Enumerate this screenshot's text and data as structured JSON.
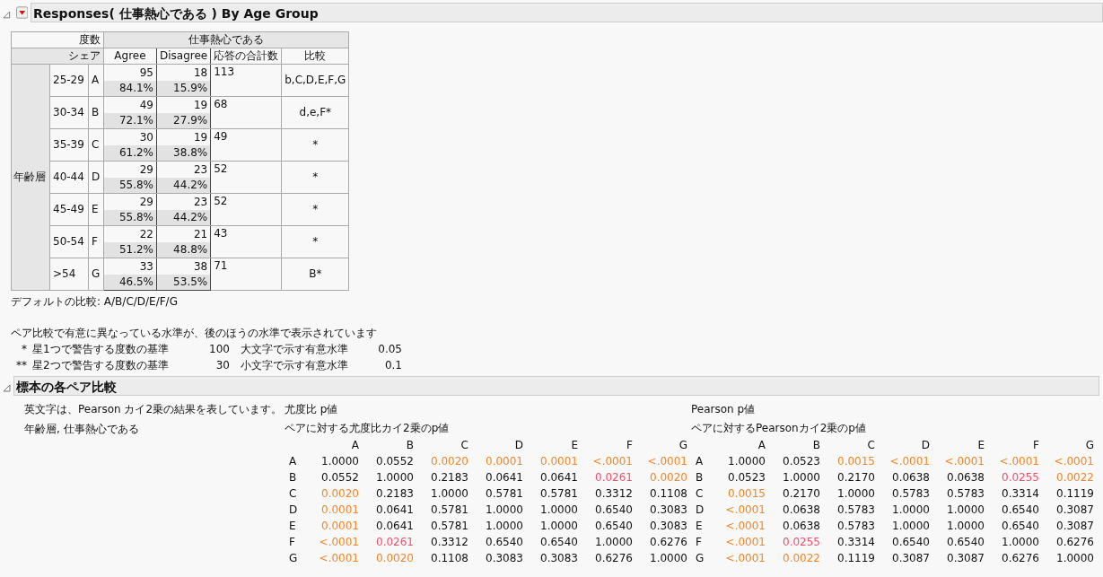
{
  "report": {
    "title": "Responses( 仕事熱心である ) By Age Group"
  },
  "crosstab": {
    "corner_top": "度数",
    "corner_bottom": "シェア",
    "column_group": "仕事熱心である",
    "columns": [
      "Agree",
      "Disagree",
      "応答の合計数",
      "比較"
    ],
    "row_group": "年齢層",
    "rows": [
      {
        "range": "25-29",
        "letter": "A",
        "counts": [
          {
            "count": "95",
            "share": "84.1%"
          },
          {
            "count": "18",
            "share": "15.9%"
          }
        ],
        "total": "113",
        "comparison": "b,C,D,E,F,G"
      },
      {
        "range": "30-34",
        "letter": "B",
        "counts": [
          {
            "count": "49",
            "share": "72.1%"
          },
          {
            "count": "19",
            "share": "27.9%"
          }
        ],
        "total": "68",
        "comparison": "d,e,F*"
      },
      {
        "range": "35-39",
        "letter": "C",
        "counts": [
          {
            "count": "30",
            "share": "61.2%"
          },
          {
            "count": "19",
            "share": "38.8%"
          }
        ],
        "total": "49",
        "comparison": "*"
      },
      {
        "range": "40-44",
        "letter": "D",
        "counts": [
          {
            "count": "29",
            "share": "55.8%"
          },
          {
            "count": "23",
            "share": "44.2%"
          }
        ],
        "total": "52",
        "comparison": "*"
      },
      {
        "range": "45-49",
        "letter": "E",
        "counts": [
          {
            "count": "29",
            "share": "55.8%"
          },
          {
            "count": "23",
            "share": "44.2%"
          }
        ],
        "total": "52",
        "comparison": "*"
      },
      {
        "range": "50-54",
        "letter": "F",
        "counts": [
          {
            "count": "22",
            "share": "51.2%"
          },
          {
            "count": "21",
            "share": "48.8%"
          }
        ],
        "total": "43",
        "comparison": "*"
      },
      {
        "range": ">54",
        "letter": "G",
        "counts": [
          {
            "count": "33",
            "share": "46.5%"
          },
          {
            "count": "38",
            "share": "53.5%"
          }
        ],
        "total": "71",
        "comparison": "B*"
      }
    ]
  },
  "default_comparison": "デフォルトの比較: A/B/C/D/E/F/G",
  "legend": {
    "intro": "ペア比較で有意に異なっている水準が、後のほうの水準で表示されています",
    "lines": [
      {
        "mark": "*",
        "label": "星1つで警告する度数の基準",
        "count": "100",
        "level_label": "大文字で示す有意水準",
        "value": "0.05"
      },
      {
        "mark": "**",
        "label": "星2つで警告する度数の基準",
        "count": "30",
        "level_label": "小文字で示す有意水準",
        "value": "0.1"
      }
    ]
  },
  "pairwise": {
    "title": "標本の各ペア比較",
    "note": "英文字は、Pearson カイ2乗の結果を表しています。",
    "variables": "年齢層, 仕事熱心である",
    "tables": [
      {
        "heading": "尤度比 p値",
        "subtitle": "ペアに対する尤度比カイ2乗のp値",
        "columns": [
          "A",
          "B",
          "C",
          "D",
          "E",
          "F",
          "G"
        ],
        "rows": [
          {
            "label": "A",
            "cells": [
              "1.0000",
              "0.0552",
              {
                "text": "0.0020",
                "color": "#f0882a"
              },
              {
                "text": "0.0001",
                "color": "#f0882a"
              },
              {
                "text": "0.0001",
                "color": "#f0882a"
              },
              {
                "text": "<.0001",
                "color": "#f0882a"
              },
              {
                "text": "<.0001",
                "color": "#f0882a"
              }
            ]
          },
          {
            "label": "B",
            "cells": [
              "0.0552",
              "1.0000",
              "0.2183",
              "0.0641",
              "0.0641",
              {
                "text": "0.0261",
                "color": "#f0506e"
              },
              {
                "text": "0.0020",
                "color": "#f0882a"
              }
            ]
          },
          {
            "label": "C",
            "cells": [
              {
                "text": "0.0020",
                "color": "#f0882a"
              },
              "0.2183",
              "1.0000",
              "0.5781",
              "0.5781",
              "0.3312",
              "0.1108"
            ]
          },
          {
            "label": "D",
            "cells": [
              {
                "text": "0.0001",
                "color": "#f0882a"
              },
              "0.0641",
              "0.5781",
              "1.0000",
              "1.0000",
              "0.6540",
              "0.3083"
            ]
          },
          {
            "label": "E",
            "cells": [
              {
                "text": "0.0001",
                "color": "#f0882a"
              },
              "0.0641",
              "0.5781",
              "1.0000",
              "1.0000",
              "0.6540",
              "0.3083"
            ]
          },
          {
            "label": "F",
            "cells": [
              {
                "text": "<.0001",
                "color": "#f0882a"
              },
              {
                "text": "0.0261",
                "color": "#f0506e"
              },
              "0.3312",
              "0.6540",
              "0.6540",
              "1.0000",
              "0.6276"
            ]
          },
          {
            "label": "G",
            "cells": [
              {
                "text": "<.0001",
                "color": "#f0882a"
              },
              {
                "text": "0.0020",
                "color": "#f0882a"
              },
              "0.1108",
              "0.3083",
              "0.3083",
              "0.6276",
              "1.0000"
            ]
          }
        ]
      },
      {
        "heading": "Pearson p値",
        "subtitle": "ペアに対するPearsonカイ2乗のp値",
        "columns": [
          "A",
          "B",
          "C",
          "D",
          "E",
          "F",
          "G"
        ],
        "rows": [
          {
            "label": "A",
            "cells": [
              "1.0000",
              "0.0523",
              {
                "text": "0.0015",
                "color": "#f0882a"
              },
              {
                "text": "<.0001",
                "color": "#f0882a"
              },
              {
                "text": "<.0001",
                "color": "#f0882a"
              },
              {
                "text": "<.0001",
                "color": "#f0882a"
              },
              {
                "text": "<.0001",
                "color": "#f0882a"
              }
            ]
          },
          {
            "label": "B",
            "cells": [
              "0.0523",
              "1.0000",
              "0.2170",
              "0.0638",
              "0.0638",
              {
                "text": "0.0255",
                "color": "#f0506e"
              },
              {
                "text": "0.0022",
                "color": "#f0882a"
              }
            ]
          },
          {
            "label": "C",
            "cells": [
              {
                "text": "0.0015",
                "color": "#f0882a"
              },
              "0.2170",
              "1.0000",
              "0.5783",
              "0.5783",
              "0.3314",
              "0.1119"
            ]
          },
          {
            "label": "D",
            "cells": [
              {
                "text": "<.0001",
                "color": "#f0882a"
              },
              "0.0638",
              "0.5783",
              "1.0000",
              "1.0000",
              "0.6540",
              "0.3087"
            ]
          },
          {
            "label": "E",
            "cells": [
              {
                "text": "<.0001",
                "color": "#f0882a"
              },
              "0.0638",
              "0.5783",
              "1.0000",
              "1.0000",
              "0.6540",
              "0.3087"
            ]
          },
          {
            "label": "F",
            "cells": [
              {
                "text": "<.0001",
                "color": "#f0882a"
              },
              {
                "text": "0.0255",
                "color": "#f0506e"
              },
              "0.3314",
              "0.6540",
              "0.6540",
              "1.0000",
              "0.6276"
            ]
          },
          {
            "label": "G",
            "cells": [
              {
                "text": "<.0001",
                "color": "#f0882a"
              },
              {
                "text": "0.0022",
                "color": "#f0882a"
              },
              "0.1119",
              "0.3087",
              "0.3087",
              "0.6276",
              "1.0000"
            ]
          }
        ]
      }
    ]
  }
}
